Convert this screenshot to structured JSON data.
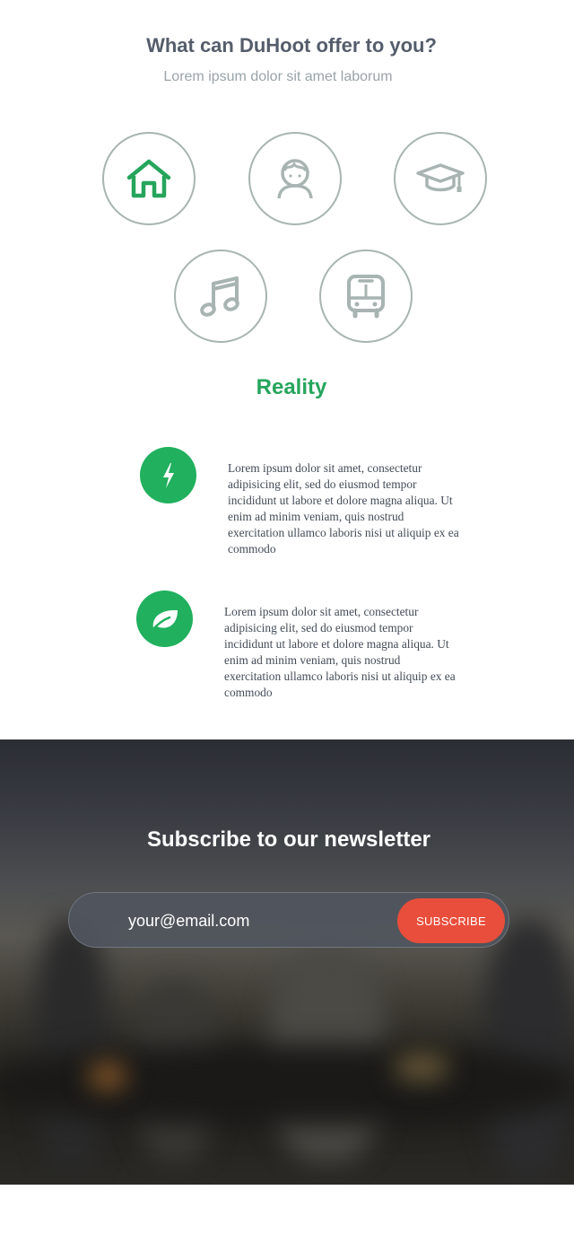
{
  "offer": {
    "title": "What can DuHoot offer to you?",
    "subtitle": "Lorem ipsum dolor sit amet laborum",
    "icons": [
      {
        "name": "home-icon",
        "color": "#25a55c",
        "active": true
      },
      {
        "name": "person-icon",
        "color": "#a8b4b2",
        "active": false
      },
      {
        "name": "graduation-cap-icon",
        "color": "#a8b4b2",
        "active": false
      },
      {
        "name": "music-note-icon",
        "color": "#a8b4b2",
        "active": false
      },
      {
        "name": "bus-icon",
        "color": "#a8b4b2",
        "active": false
      }
    ],
    "section_title": "Reality"
  },
  "features": [
    {
      "icon": "lightning-icon",
      "text": "Lorem ipsum dolor sit amet, consectetur adipisicing elit, sed do eiusmod tempor incididunt ut labore et dolore magna aliqua. Ut enim ad minim veniam, quis nostrud exercitation ullamco laboris nisi ut aliquip ex ea commodo"
    },
    {
      "icon": "leaf-icon",
      "text": "Lorem ipsum dolor sit amet, consectetur adipisicing elit, sed do eiusmod tempor incididunt ut labore et dolore magna aliqua. Ut enim ad minim veniam, quis nostrud exercitation ullamco laboris nisi ut aliquip ex ea commodo"
    }
  ],
  "newsletter": {
    "title": "Subscribe to our newsletter",
    "email_value": "your@email.com",
    "button_label": "SUBSCRIBE"
  },
  "colors": {
    "accent_green": "#20b05e",
    "subscribe_red": "#e84e3b",
    "heading_gray": "#555d6b"
  }
}
